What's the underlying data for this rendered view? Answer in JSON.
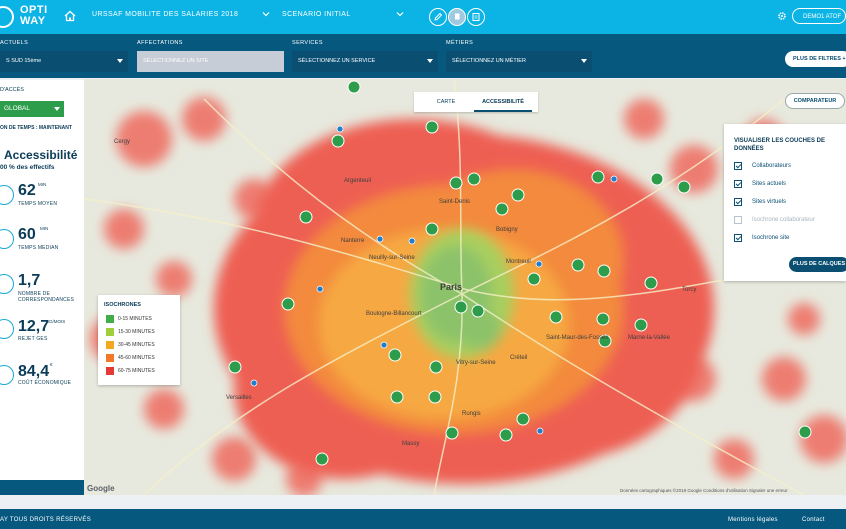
{
  "brand": {
    "line1": "OPTI",
    "line2": "WAY"
  },
  "topbar": {
    "study": "URSSAF MOBILITE DES SALARIES 2018",
    "scenario": "SCENARIO INITIAL",
    "demo": "DEMO1 ATOF"
  },
  "filters": {
    "current": {
      "label": "ACTUELS",
      "value": "S SUD 15ème"
    },
    "assignments": {
      "label": "AFFECTATIONS",
      "value": "SÉLECTIONNEZ UN SITE"
    },
    "services": {
      "label": "SERVICES",
      "value": "SÉLECTIONNEZ UN SERVICE"
    },
    "jobs": {
      "label": "MÉTIERS",
      "value": "SÉLECTIONNEZ UN MÉTIER"
    },
    "more_filters": "PLUS DE FILTRES +"
  },
  "left_panel": {
    "access_label": "D'ACCÈS",
    "access_value": "GLOBAL",
    "time_label": "ON DE TEMPS : MAINTENANT",
    "heading": "Accessibilité",
    "subheading": "00 % des effectifs",
    "metrics": [
      {
        "value": "62",
        "unit": "MIN",
        "label": "TEMPS MOYEN",
        "icon": "clock-icon"
      },
      {
        "value": "60",
        "unit": "MIN",
        "label": "TEMPS MEDIAN",
        "icon": "clock-icon"
      },
      {
        "value": "1,7",
        "unit": "",
        "label": "NOMBRE DE CORRESPONDANCES",
        "icon": "transfer-icon"
      },
      {
        "value": "12,7",
        "unit": "KG/MOIS",
        "label": "REJET GES",
        "icon": "co2-icon"
      },
      {
        "value": "84,4",
        "unit": "€",
        "label": "COÛT ÉCONOMIQUE",
        "icon": "money-icon"
      }
    ]
  },
  "map": {
    "tabs": [
      "CARTE",
      "ACCESSIBILITÉ"
    ],
    "comparator": "COMPARATEUR",
    "layers_title": "VISUALISER LES COUCHES DE DONNÉES",
    "layers": [
      {
        "label": "Collaborateurs",
        "checked": true
      },
      {
        "label": "Sites actuels",
        "checked": true
      },
      {
        "label": "Sites virtuels",
        "checked": true
      },
      {
        "label": "Isochrone collaborateur",
        "checked": false
      },
      {
        "label": "Isochrone site",
        "checked": true
      }
    ],
    "more_layers": "PLUS DE CALQUES",
    "legend_title": "ISOCHRONES",
    "legend": [
      {
        "label": "0-15 MINUTES",
        "color": "#3fae49"
      },
      {
        "label": "15-30 MINUTES",
        "color": "#9fcf3b"
      },
      {
        "label": "30-45 MINUTES",
        "color": "#f5a623"
      },
      {
        "label": "45-60 MINUTES",
        "color": "#f07a28"
      },
      {
        "label": "60-75 MINUTES",
        "color": "#e53935"
      }
    ],
    "place_labels": [
      "Paris",
      "Saint-Denis",
      "Bobigny",
      "Créteil",
      "Nanterre",
      "Versailles",
      "Neuilly-sur-Seine",
      "Vitry-sur-Seine",
      "Saint-Maur-des-Fossés",
      "Marne-la-Vallée",
      "Argenteuil",
      "Cergy",
      "Boulogne-Billancourt",
      "Rungis",
      "Massy",
      "Torcy",
      "Montreuil"
    ],
    "google": "Google",
    "attribution": "Données cartographiques ©2018 Google   Conditions d'utilisation   Signaler une erreur"
  },
  "footer": {
    "copyright": "AY TOUS DROITS RÉSERVÉS",
    "legal": "Mentions légales",
    "contact": "Contact"
  },
  "colors": {
    "cyan": "#0cb4e6",
    "navy": "#06587e",
    "green": "#2d9d4c"
  }
}
